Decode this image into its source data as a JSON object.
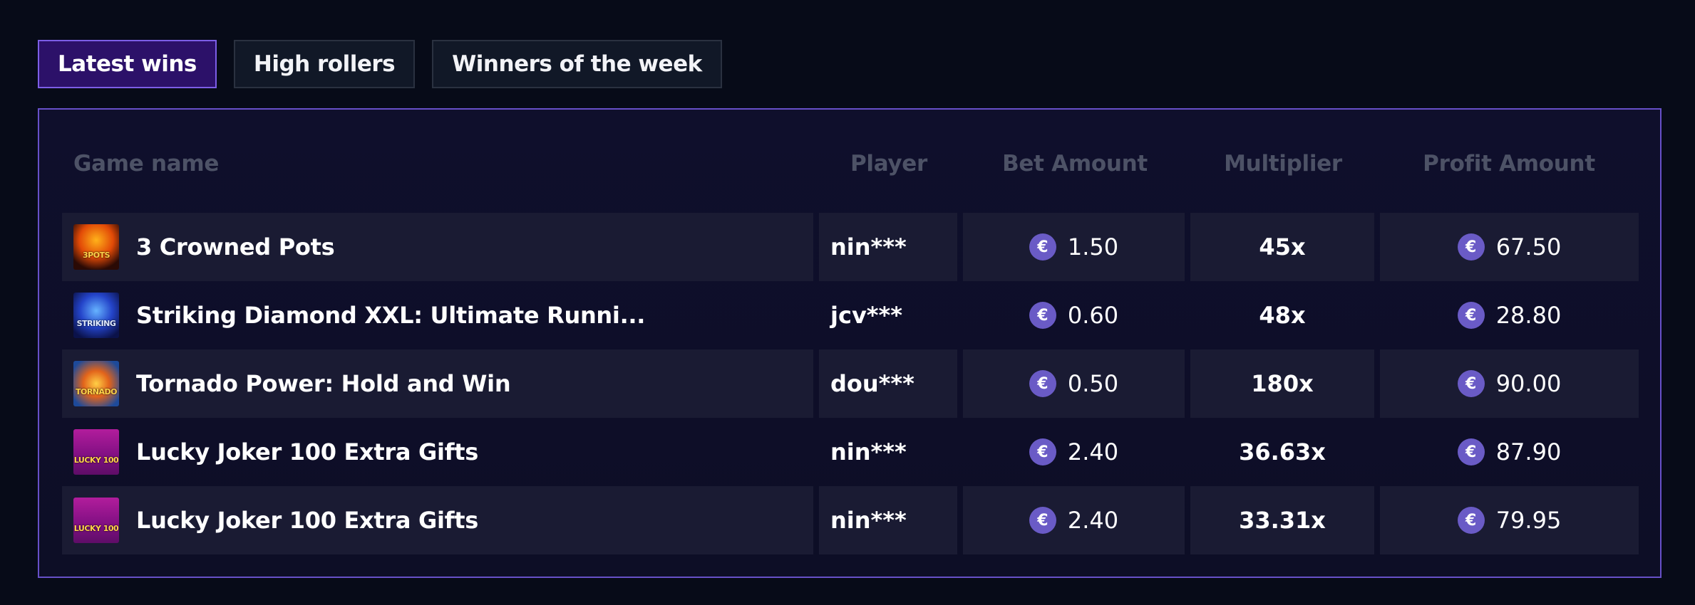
{
  "tabs": [
    {
      "label": "Latest wins",
      "active": true
    },
    {
      "label": "High rollers",
      "active": false
    },
    {
      "label": "Winners of the week",
      "active": false
    }
  ],
  "table": {
    "columns": [
      "Game name",
      "Player",
      "Bet Amount",
      "Multiplier",
      "Profit Amount"
    ],
    "currency_icon": "euro-coin-icon",
    "currency_symbol": "€",
    "rows": [
      {
        "game": "3 Crowned Pots",
        "thumb_label": "3POTS",
        "player": "nin***",
        "bet": "1.50",
        "multiplier": "45x",
        "profit": "67.50"
      },
      {
        "game": "Striking Diamond XXL: Ultimate Runni...",
        "thumb_label": "STRIKING",
        "player": "jcv***",
        "bet": "0.60",
        "multiplier": "48x",
        "profit": "28.80"
      },
      {
        "game": "Tornado Power: Hold and Win",
        "thumb_label": "TORNADO",
        "player": "dou***",
        "bet": "0.50",
        "multiplier": "180x",
        "profit": "90.00"
      },
      {
        "game": "Lucky Joker 100 Extra Gifts",
        "thumb_label": "LUCKY 100",
        "player": "nin***",
        "bet": "2.40",
        "multiplier": "36.63x",
        "profit": "87.90"
      },
      {
        "game": "Lucky Joker 100 Extra Gifts",
        "thumb_label": "LUCKY 100",
        "player": "nin***",
        "bet": "2.40",
        "multiplier": "33.31x",
        "profit": "79.95"
      }
    ]
  },
  "colors": {
    "background": "#070b18",
    "accent": "#6750c8",
    "active_tab": "#2c1169",
    "coin": "#6a5bc6"
  }
}
